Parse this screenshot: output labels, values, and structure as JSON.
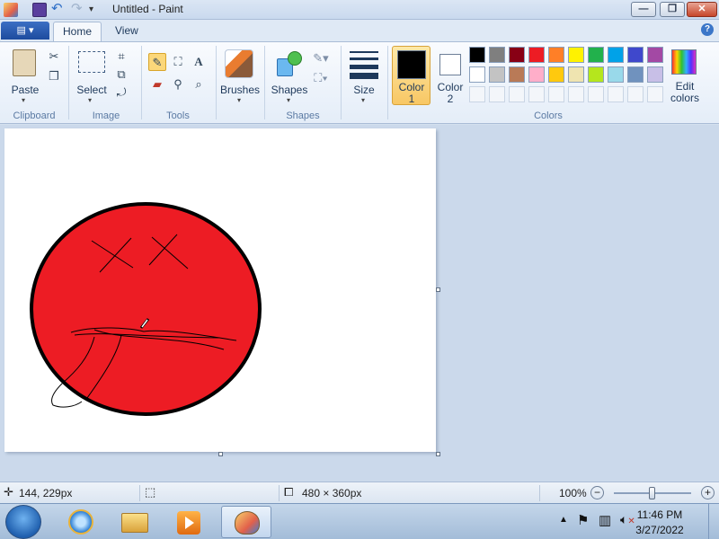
{
  "window": {
    "title": "Untitled - Paint",
    "minimize_glyph": "—",
    "maximize_glyph": "❐",
    "close_glyph": "✕"
  },
  "quick_access": {
    "icons": [
      "paint-app-icon",
      "save-icon",
      "undo-icon",
      "redo-icon",
      "customize-toolbar-icon"
    ]
  },
  "tabs": {
    "app_menu_glyph": "▤ ▾",
    "home": "Home",
    "view": "View",
    "help_glyph": "?"
  },
  "ribbon": {
    "clipboard": {
      "paste": "Paste",
      "group": "Clipboard"
    },
    "image": {
      "select": "Select",
      "group": "Image"
    },
    "tools": {
      "group": "Tools",
      "text_glyph": "A"
    },
    "brushes": {
      "label": "Brushes"
    },
    "shapes": {
      "label": "Shapes",
      "group": "Shapes"
    },
    "size": {
      "label": "Size"
    },
    "colors": {
      "color1_line1": "Color",
      "color1_line2": "1",
      "color2_line1": "Color",
      "color2_line2": "2",
      "edit_line1": "Edit",
      "edit_line2": "colors",
      "group": "Colors",
      "color1_value": "#000000",
      "color2_value": "#ffffff",
      "palette_row1": [
        "#000000",
        "#7f7f7f",
        "#880015",
        "#ed1c24",
        "#ff7f27",
        "#fff200",
        "#22b14c",
        "#00a2e8",
        "#3f48cc",
        "#a349a4"
      ],
      "palette_row2": [
        "#ffffff",
        "#c3c3c3",
        "#b97a57",
        "#ffaec9",
        "#ffc90e",
        "#efe4b0",
        "#b5e61d",
        "#99d9ea",
        "#7092be",
        "#c8bfe7"
      ]
    }
  },
  "canvas": {
    "fill_color": "#ed1c24",
    "outline_color": "#000000"
  },
  "status": {
    "cursor_pos": "144, 229px",
    "image_size": "480 × 360px",
    "zoom": "100%",
    "zoom_level": 1.0
  },
  "taskbar": {
    "time": "11:46 PM",
    "date": "3/27/2022",
    "apps": [
      "internet-explorer-icon",
      "file-explorer-icon",
      "media-player-icon",
      "paint-taskbar-icon"
    ]
  }
}
